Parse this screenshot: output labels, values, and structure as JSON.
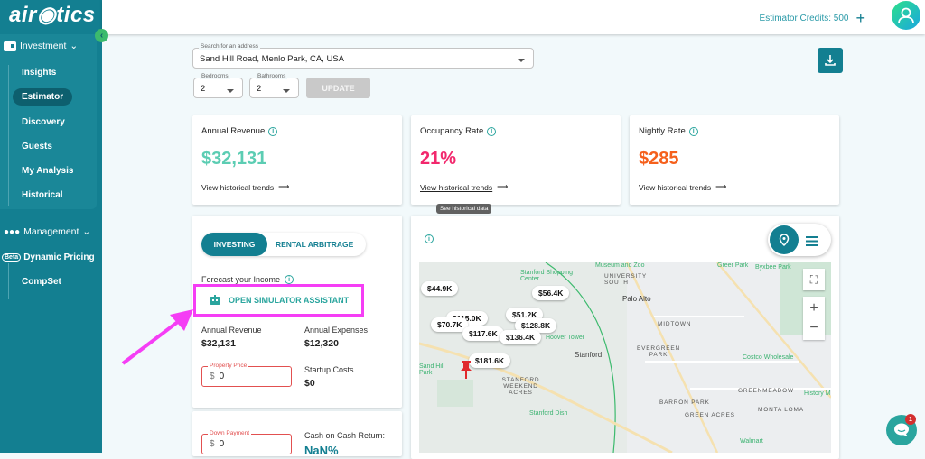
{
  "app": {
    "logo": "air◉tics"
  },
  "sidebar": {
    "groups": [
      {
        "label": "Investment",
        "icon": "wallet-icon",
        "items": [
          "Insights",
          "Estimator",
          "Discovery",
          "Guests",
          "My Analysis",
          "Historical"
        ],
        "active": "Estimator"
      },
      {
        "label": "Management",
        "icon": "people-icon",
        "items": [
          "Dynamic Pricing",
          "CompSet"
        ],
        "beta_badge": "Beta"
      }
    ]
  },
  "topbar": {
    "credits_label": "Estimator Credits: 500",
    "add_icon": "plus-icon",
    "avatar_icon": "user-icon"
  },
  "search": {
    "address_label": "Search for an address",
    "address_value": "Sand Hill Road, Menlo Park, CA, USA",
    "bedrooms_label": "Bedrooms",
    "bedrooms_value": "2",
    "bathrooms_label": "Bathrooms",
    "bathrooms_value": "2",
    "update_label": "UPDATE"
  },
  "metrics": [
    {
      "title": "Annual Revenue",
      "value": "$32,131",
      "color": "#5ccdb3",
      "link": "View historical trends"
    },
    {
      "title": "Occupancy Rate",
      "value": "21%",
      "color": "#f2286d",
      "link": "View historical trends"
    },
    {
      "title": "Nightly Rate",
      "value": "$285",
      "color": "#f5601c",
      "link": "View historical trends"
    }
  ],
  "tooltip": "See historical data",
  "forecast": {
    "tabs": [
      "INVESTING",
      "RENTAL ARBITRAGE"
    ],
    "title": "Forecast your Income",
    "simulator_label": "OPEN SIMULATOR ASSISTANT",
    "annual_revenue_label": "Annual Revenue",
    "annual_revenue": "$32,131",
    "annual_expenses_label": "Annual Expenses",
    "annual_expenses": "$12,320",
    "property_price_label": "Property Price",
    "property_price_value": "0",
    "currency": "$",
    "startup_costs_label": "Startup Costs",
    "startup_costs": "$0",
    "down_payment_label": "Down Payment",
    "down_payment_value": "0",
    "coc_label": "Cash on Cash Return:",
    "coc_value": "NaN%"
  },
  "map": {
    "price_tags": [
      "$44.9K",
      "$56.4K",
      "$115.0K",
      "$51.2K",
      "$70.7K",
      "$128.8K",
      "$117.6K",
      "$136.4K",
      "$181.6K"
    ],
    "labels": [
      "Museum and Zoo",
      "Stanford Shopping Center",
      "UNIVERSITY SOUTH",
      "Palo Alto",
      "Greer Park",
      "Byxbee Park",
      "MIDTOWN",
      "EVERGREEN PARK",
      "Stanford",
      "STANFORD WEEKEND ACRES",
      "Stanford Dish",
      "Costco Wholesale",
      "GREENMEADOW",
      "BARRON PARK",
      "GREEN ACRES",
      "MONTA LOMA",
      "Walmart",
      "History M",
      "Hoover Tower",
      "Sand Hill Park"
    ]
  },
  "chat_badge": "1"
}
